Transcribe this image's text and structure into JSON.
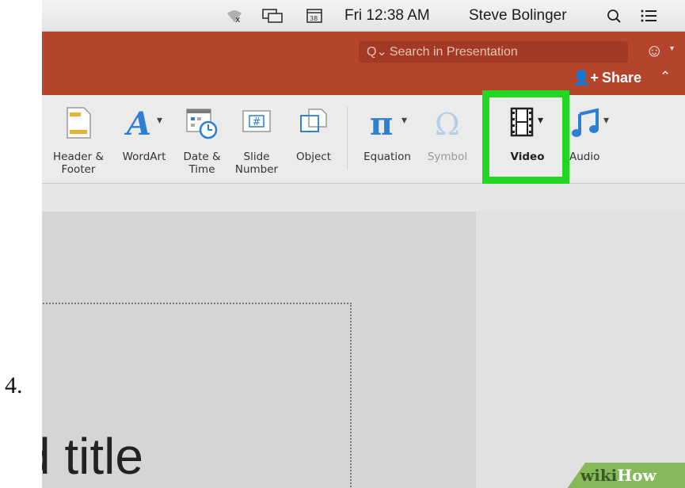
{
  "step": {
    "number": "4."
  },
  "menubar": {
    "clock": "Fri 12:38 AM",
    "user": "Steve Bolinger",
    "icons": [
      "wifi-off-icon",
      "airplay-icon",
      "calendar-icon",
      "search-icon",
      "list-icon"
    ]
  },
  "title_bar": {
    "search_placeholder": "Search in Presentation",
    "share_label": "Share",
    "smiley": "☺"
  },
  "ribbon": {
    "buttons": [
      {
        "label": "Header &\nFooter",
        "icon": "header-footer-icon",
        "enabled": true
      },
      {
        "label": "WordArt",
        "icon": "wordart-icon",
        "enabled": true
      },
      {
        "label": "Date &\nTime",
        "icon": "date-time-icon",
        "enabled": true
      },
      {
        "label": "Slide\nNumber",
        "icon": "slide-number-icon",
        "enabled": true
      },
      {
        "label": "Object",
        "icon": "object-icon",
        "enabled": true
      },
      {
        "label": "Equation",
        "icon": "equation-icon",
        "enabled": true
      },
      {
        "label": "Symbol",
        "icon": "symbol-icon",
        "enabled": false
      },
      {
        "label": "Video",
        "icon": "video-icon",
        "enabled": true,
        "highlighted": true
      },
      {
        "label": "Audio",
        "icon": "audio-icon",
        "enabled": true
      }
    ],
    "highlight_color": "#22d622"
  },
  "slide": {
    "title_text": "d title"
  },
  "watermark": {
    "wiki": "wiki",
    "how": "How"
  },
  "colors": {
    "ribbon_band": "#b5442d",
    "accent_blue": "#2c7fd1"
  }
}
